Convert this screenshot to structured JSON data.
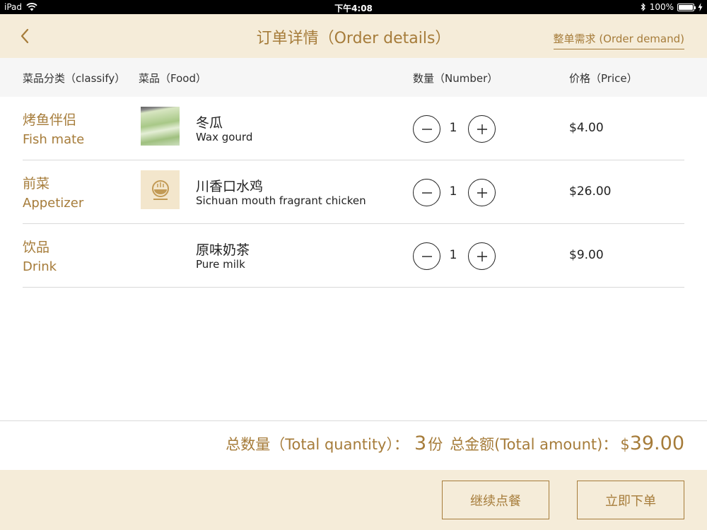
{
  "status_bar": {
    "device": "iPad",
    "time": "下午4:08",
    "battery": "100%",
    "battery_level": 1.0
  },
  "nav": {
    "title": "订单详情（Order details）",
    "order_demand": "整单需求 (Order demand)"
  },
  "table": {
    "headers": {
      "classify": "菜品分类（classify）",
      "food": "菜品（Food）",
      "number": "数量（Number）",
      "price": "价格（Price）"
    },
    "rows": [
      {
        "category_cn": "烤鱼伴侣",
        "category_en": "Fish mate",
        "food_cn": "冬瓜",
        "food_en": "Wax gourd",
        "quantity": "1",
        "price": "$4.00",
        "thumb": "wax-gourd-photo"
      },
      {
        "category_cn": "前菜",
        "category_en": "Appetizer",
        "food_cn": "川香口水鸡",
        "food_en": "Sichuan mouth fragrant chicken",
        "quantity": "1",
        "price": "$26.00",
        "thumb": "restaurant-logo"
      },
      {
        "category_cn": "饮品",
        "category_en": "Drink",
        "food_cn": "原味奶茶",
        "food_en": "Pure milk",
        "quantity": "1",
        "price": "$9.00",
        "thumb": ""
      }
    ]
  },
  "summary": {
    "total_quantity_label": "总数量（Total quantity）：",
    "total_quantity_value": "3",
    "total_quantity_unit": "份",
    "total_amount_label": "总金额(Total amount)：",
    "currency": "$",
    "total_amount_value": "39.00"
  },
  "footer": {
    "continue_label": "继续点餐",
    "place_order_label": "立即下单"
  },
  "colors": {
    "accent": "#a67c3a",
    "nav_bg": "#f5ecd9",
    "header_bg": "#f6f6f6",
    "divider": "#d9d9d9"
  },
  "icons": {
    "back": "chevron-left-icon",
    "minus": "minus-circle-icon",
    "plus": "plus-circle-icon",
    "wifi": "wifi-icon",
    "bluetooth": "bluetooth-icon",
    "battery": "battery-icon",
    "charging": "charging-bolt-icon"
  }
}
